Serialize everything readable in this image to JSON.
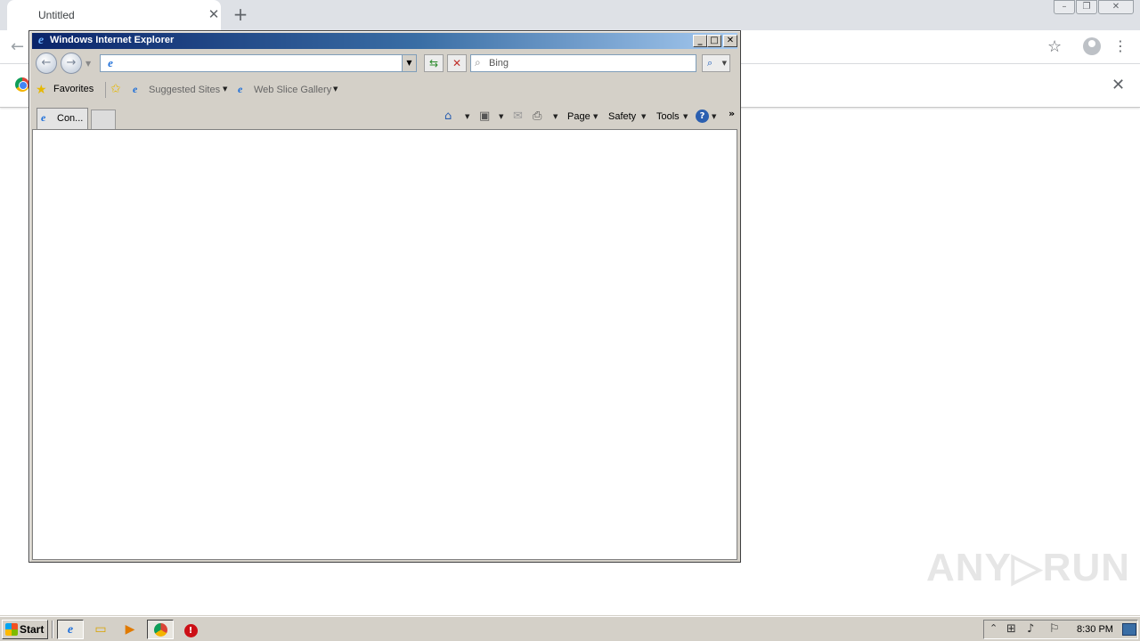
{
  "chrome": {
    "tab_title": "Untitled",
    "tab_close": "✕",
    "new_tab": "+",
    "minimize": "–",
    "restore": "❐",
    "close": "✕",
    "back": "←",
    "bookmark": "☆",
    "menu": "⋮",
    "infobar_close": "✕"
  },
  "ie": {
    "title": "Windows Internet Explorer",
    "caption": {
      "minimize": "_",
      "maximize": "□",
      "close": "✕"
    },
    "address_value": "",
    "search_placeholder": "Bing",
    "favorites": {
      "label": "Favorites",
      "items": [
        "Suggested Sites",
        "Web Slice Gallery"
      ]
    },
    "tab": {
      "label": "Con..."
    },
    "command_bar": {
      "page": "Page",
      "safety": "Safety",
      "tools": "Tools"
    }
  },
  "watermark": "ANY▷RUN",
  "taskbar": {
    "start_label": "Start",
    "clock": "8:30 PM"
  },
  "icons": {
    "ie": "ie-icon",
    "home": "home-icon",
    "feeds": "rss-icon",
    "mail": "mail-icon",
    "print": "print-icon",
    "help": "help-icon",
    "explorer": "folder-icon",
    "media": "media-player-icon",
    "chrome": "chrome-icon",
    "opera": "opera-icon"
  },
  "colors": {
    "ie_titlebar_start": "#0a246a",
    "ie_titlebar_end": "#a6caf0",
    "window_face": "#d4d0c8",
    "chrome_tabbar": "#dee1e6"
  }
}
